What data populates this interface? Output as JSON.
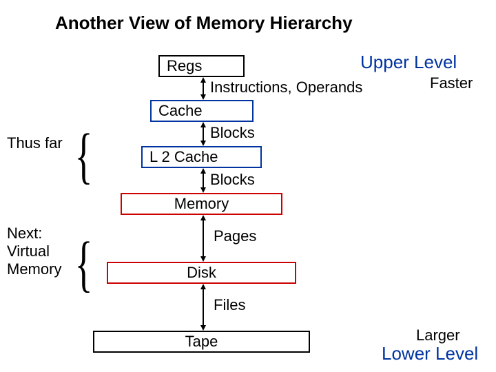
{
  "title": "Another View of Memory Hierarchy",
  "upper_level": "Upper Level",
  "faster": "Faster",
  "larger": "Larger",
  "lower_level": "Lower Level",
  "side": {
    "thus_far": "Thus far",
    "next1": "Next:",
    "next2": "Virtual",
    "next3": "Memory"
  },
  "boxes": {
    "regs": "Regs",
    "cache": "Cache",
    "l2": "L 2 Cache",
    "memory": "Memory",
    "disk": "Disk",
    "tape": "Tape"
  },
  "transfers": {
    "instr": "Instructions, Operands",
    "blocks1": "Blocks",
    "blocks2": "Blocks",
    "pages": "Pages",
    "files": "Files"
  }
}
